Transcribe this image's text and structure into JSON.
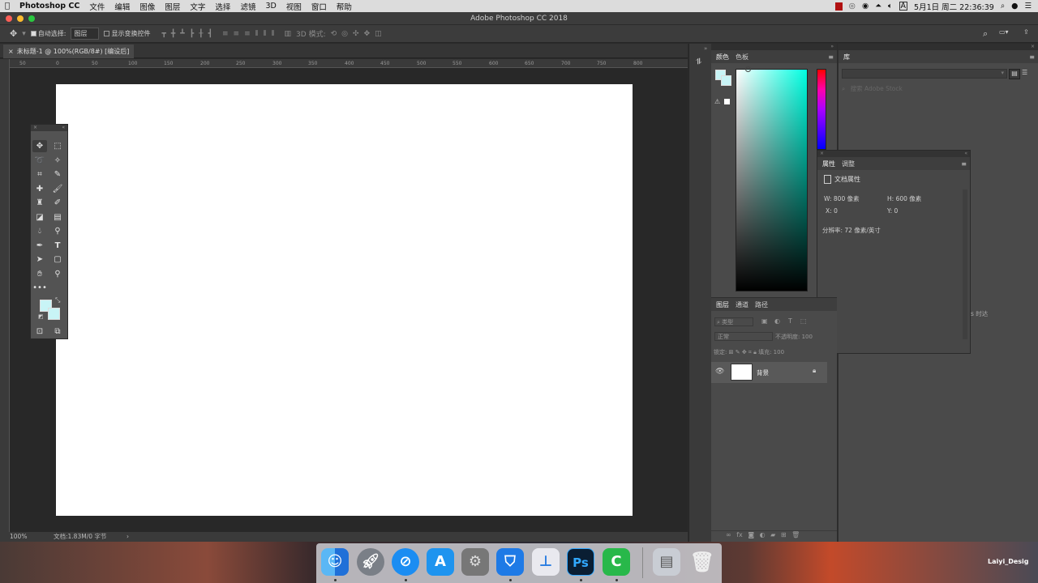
{
  "menubar": {
    "app_name": "Photoshop CC",
    "items": [
      "文件",
      "编辑",
      "图像",
      "图层",
      "文字",
      "选择",
      "滤镜",
      "3D",
      "视图",
      "窗口",
      "帮助"
    ],
    "clock": "5月1日 周二  22:36:39"
  },
  "window": {
    "title": "Adobe Photoshop CC 2018"
  },
  "options_bar": {
    "auto_select_label": "自动选择:",
    "auto_select_value": "图层",
    "show_transform_label": "显示变换控件",
    "mode_3d_label": "3D 模式:"
  },
  "document": {
    "tab_label": "未标题-1 @ 100%(RGB/8#) [编设后]",
    "ruler_ticks": [
      "50",
      "0",
      "50",
      "100",
      "150",
      "200",
      "250",
      "300",
      "350",
      "400",
      "450",
      "500",
      "550",
      "600",
      "650",
      "700",
      "750",
      "800"
    ],
    "zoom": "100%",
    "doc_size": "文档:1.83M/0 字节"
  },
  "color_panel": {
    "tabs": [
      "颜色",
      "色板"
    ],
    "active_tab": "颜色",
    "foreground_color": "#c8f4f6",
    "hue_color": "#00ffe1"
  },
  "library_panel": {
    "title": "库",
    "search_placeholder": "搜索 Adobe Stock",
    "hint_fragment": "s 时达"
  },
  "properties_panel": {
    "tabs": [
      "属性",
      "调整"
    ],
    "active_tab": "属性",
    "section": "文档属性",
    "w_label": "W:",
    "w_value": "800 像素",
    "h_label": "H:",
    "h_value": "600 像素",
    "x_label": "X:",
    "x_value": "0",
    "y_label": "Y:",
    "y_value": "0",
    "resolution": "分辨率: 72 像素/英寸"
  },
  "layers_panel": {
    "tabs": [
      "图层",
      "通道",
      "路径"
    ],
    "active_tab": "图层",
    "filter_label": "类型",
    "blend_mode": "正常",
    "opacity_label": "不透明度:",
    "opacity_value": "100",
    "lock_label": "锁定:",
    "fill_label": "填充:",
    "fill_value": "100",
    "layers": [
      {
        "name": "背景",
        "visible": true,
        "locked": true
      }
    ]
  },
  "dock": {
    "apps": [
      "finder",
      "launchpad",
      "safari",
      "app-store",
      "system-preferences",
      "tencent-pc-manager",
      "keynote",
      "photoshop",
      "camtasia",
      "preview",
      "trash"
    ],
    "photoshop_label": "Ps",
    "watermark": "Laiyi_Desig"
  }
}
